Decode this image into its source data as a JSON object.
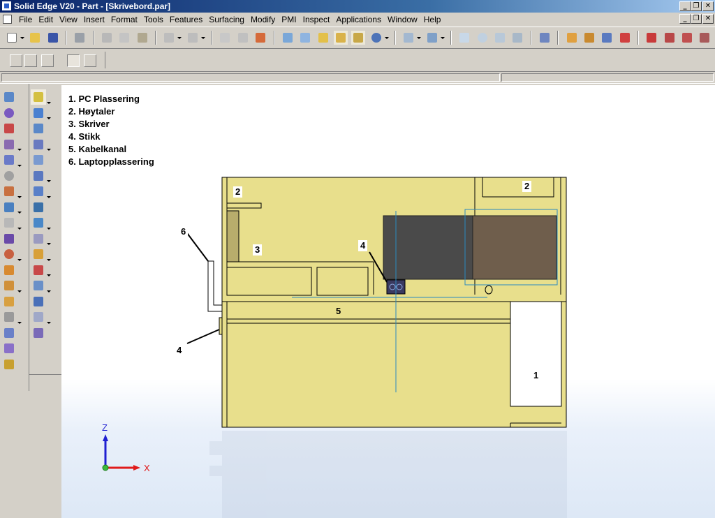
{
  "window": {
    "title": "Solid Edge V20 - Part - [Skrivebord.par]",
    "controls": [
      "_",
      "❐",
      "✕"
    ]
  },
  "menu": [
    "File",
    "Edit",
    "View",
    "Insert",
    "Format",
    "Tools",
    "Features",
    "Surfacing",
    "Modify",
    "PMI",
    "Inspect",
    "Applications",
    "Window",
    "Help"
  ],
  "legend": [
    "1. PC Plassering",
    "2. Høytaler",
    "3. Skriver",
    "4. Stikk",
    "5. Kabelkanal",
    "6. Laptopplassering"
  ],
  "callouts": {
    "c1": "1",
    "c2a": "2",
    "c2b": "2",
    "c3": "3",
    "c4a": "4",
    "c4b": "4",
    "c5": "5",
    "c6": "6"
  },
  "axes": {
    "z": "Z",
    "x": "X"
  },
  "colors": {
    "model_fill": "#e8df8c",
    "model_edge": "#000000",
    "dark_block": "#4a4a4a",
    "brown_block": "#6f5e4c",
    "axis_blue": "#1f1fd1",
    "axis_red": "#e01b1b",
    "construction_line": "#2a8ac0",
    "titlebar_start": "#0a246a"
  }
}
